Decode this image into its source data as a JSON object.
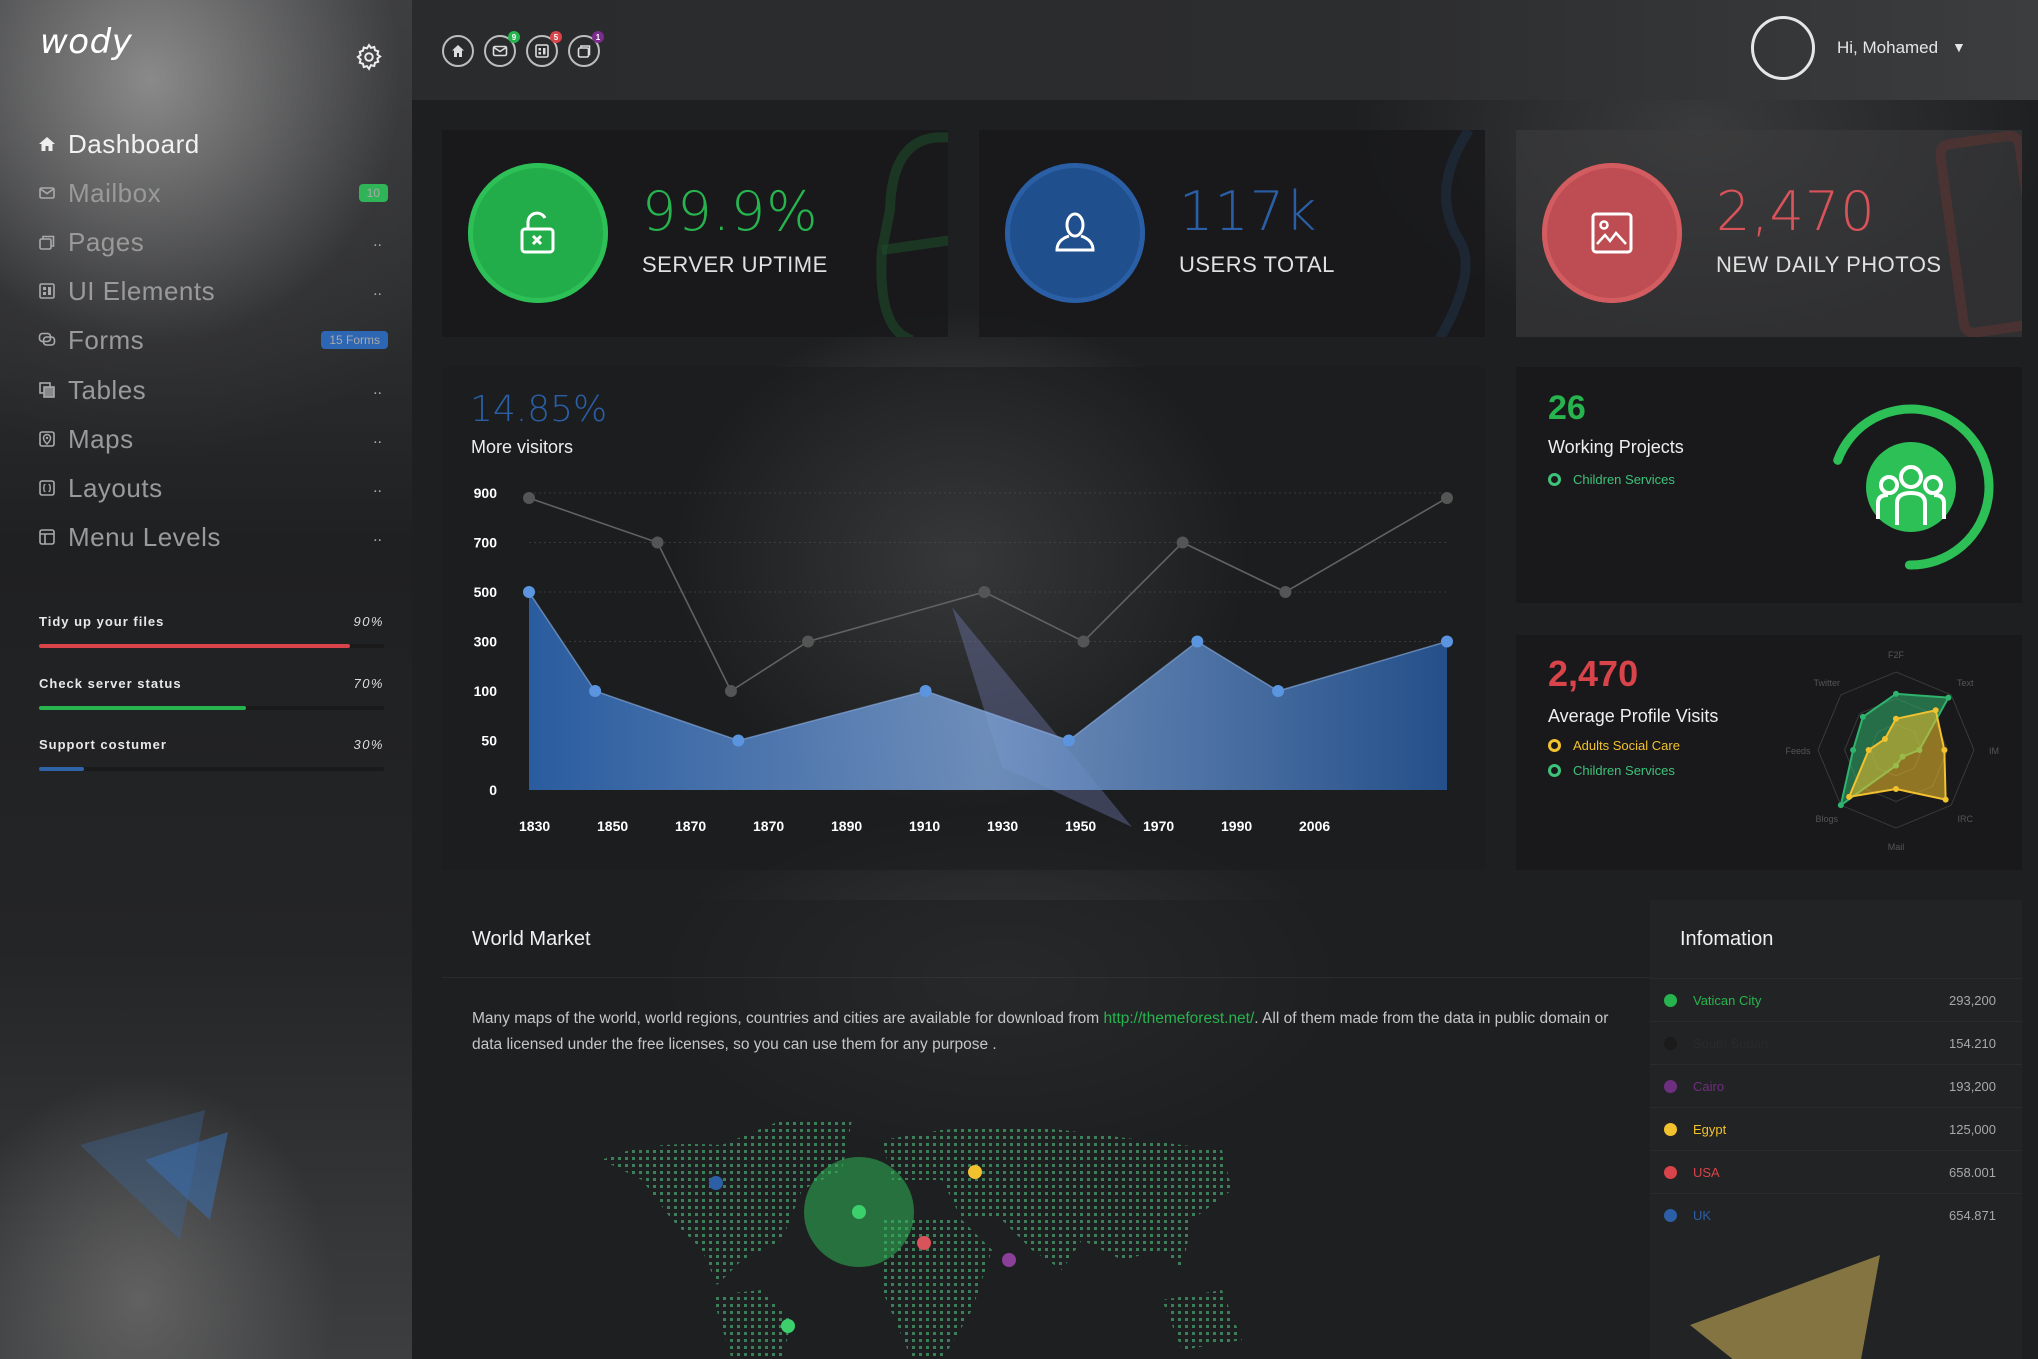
{
  "app": {
    "logo": "wody"
  },
  "sidebar": {
    "items": [
      {
        "label": "Dashboard",
        "icon": "home-icon",
        "active": true,
        "right": ""
      },
      {
        "label": "Mailbox",
        "icon": "mail-icon",
        "right": "10",
        "badge_color": "#2fb457"
      },
      {
        "label": "Pages",
        "icon": "pages-icon",
        "right": ".."
      },
      {
        "label": "UI Elements",
        "icon": "layout-grid-icon",
        "right": ".."
      },
      {
        "label": "Forms",
        "icon": "chat-bubbles-icon",
        "right": "15 Forms",
        "badge_color": "#2d66b2"
      },
      {
        "label": "Tables",
        "icon": "tables-icon",
        "right": ".."
      },
      {
        "label": "Maps",
        "icon": "map-pin-icon",
        "right": ".."
      },
      {
        "label": "Layouts",
        "icon": "code-braces-icon",
        "right": ".."
      },
      {
        "label": "Menu Levels",
        "icon": "window-icon",
        "right": ".."
      }
    ],
    "tasks": [
      {
        "label": "Tidy up your files",
        "percent_label": "90%",
        "progress": 0.9,
        "color": "#d9434a"
      },
      {
        "label": "Check server status",
        "percent_label": "70%",
        "progress": 0.6,
        "color": "#27b44e"
      },
      {
        "label": "Support costumer",
        "percent_label": "30%",
        "progress": 0.13,
        "color": "#2f64a8"
      }
    ]
  },
  "topbar": {
    "icons": [
      {
        "name": "home-icon",
        "badge": ""
      },
      {
        "name": "mail-icon",
        "badge": "9",
        "badge_color": "#27b44e"
      },
      {
        "name": "layout-icon",
        "badge": "5",
        "badge_color": "#d9434a"
      },
      {
        "name": "folders-icon",
        "badge": "1",
        "badge_color": "#7b2d8e"
      }
    ],
    "greeting": "Hi, Mohamed",
    "dropdown_caret": "▼"
  },
  "stats": [
    {
      "value": "99.9%",
      "label": "SERVER UPTIME",
      "color": "#27b44e",
      "icon": "unlock-icon"
    },
    {
      "value": "117k",
      "label": "USERS TOTAL",
      "color": "#2a5fa6",
      "icon": "user-icon"
    },
    {
      "value": "2,470",
      "label": "NEW DAILY PHOTOS",
      "color": "#d9535a",
      "icon": "image-icon"
    }
  ],
  "visitors": {
    "value": "14.85%",
    "label": "More visitors"
  },
  "chart_data": {
    "type": "area",
    "title": "More visitors",
    "xlabel": "",
    "ylabel": "",
    "x_tick_labels": [
      "1830",
      "1850",
      "1870",
      "1870",
      "1890",
      "1910",
      "1930",
      "1950",
      "1970",
      "1990",
      "2006"
    ],
    "y_tick_labels": [
      "900",
      "700",
      "500",
      "300",
      "100",
      "50",
      "0"
    ],
    "y_ticks": [
      0,
      50,
      100,
      300,
      500,
      700,
      900
    ],
    "grid": true,
    "series": [
      {
        "name": "Gray line",
        "kind": "line",
        "color": "#5a5a5a",
        "x": [
          0,
          1.75,
          2.75,
          3.8,
          6.2,
          7.55,
          8.9,
          10.3,
          12.5
        ],
        "values": [
          880,
          700,
          100,
          300,
          500,
          300,
          700,
          500,
          880
        ]
      },
      {
        "name": "Blue area",
        "kind": "area",
        "color": "#2d5fa6",
        "x": [
          0,
          0.9,
          2.85,
          5.4,
          7.35,
          9.1,
          10.2,
          12.5
        ],
        "values": [
          500,
          100,
          50,
          100,
          50,
          300,
          100,
          300
        ]
      }
    ]
  },
  "projects": {
    "value": "26",
    "label": "Working Projects",
    "legend": "Children Services",
    "progress": 0.75
  },
  "profile_visits": {
    "value": "2,470",
    "label": "Average Profile Visits",
    "legend": [
      {
        "label": "Adults Social Care",
        "color": "#f2c12e"
      },
      {
        "label": "Children Services",
        "color": "#3ec27a"
      }
    ],
    "radar": {
      "axes": [
        "F2F",
        "Text",
        "IM",
        "IRC",
        "Mail",
        "Blogs",
        "Feeds",
        "Twitter"
      ],
      "series": [
        {
          "name": "Children Services",
          "color": "#2fb46e",
          "values": [
            0.72,
            0.95,
            0.3,
            0.12,
            0.2,
            1.0,
            0.55,
            0.6
          ]
        },
        {
          "name": "Adults Social Care",
          "color": "#f2c12e",
          "values": [
            0.4,
            0.72,
            0.62,
            0.9,
            0.5,
            0.85,
            0.35,
            0.2
          ]
        }
      ]
    }
  },
  "world_market": {
    "title": "World Market",
    "text_before": "Many maps of the world, world regions, countries and cities are available for download from ",
    "link": "http://themeforest.net/",
    "text_after": ". All of them made from the data in public domain or data licensed under the free licenses, so you can use them for any purpose ."
  },
  "information": {
    "title": "Infomation",
    "rows": [
      {
        "name": "Vatican City",
        "value": "293,200",
        "color": "#27b44e"
      },
      {
        "name": "South Sudan",
        "value": "154.210",
        "color": "#1b1b1c"
      },
      {
        "name": "Cairo",
        "value": "193,200",
        "color": "#6f2f80"
      },
      {
        "name": "Egypt",
        "value": "125,000",
        "color": "#f2c12e"
      },
      {
        "name": "USA",
        "value": "658.001",
        "color": "#d9434a"
      },
      {
        "name": "UK",
        "value": "654.871",
        "color": "#2d5fa6"
      }
    ]
  }
}
